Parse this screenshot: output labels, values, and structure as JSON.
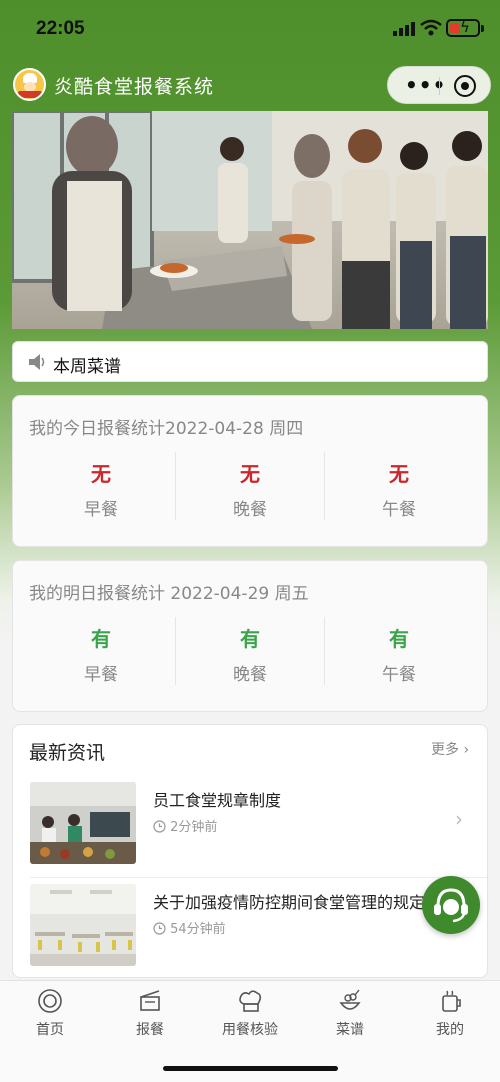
{
  "status_bar": {
    "time": "22:05",
    "icons": [
      "signal-icon",
      "wifi-icon",
      "battery-charging-icon"
    ]
  },
  "header": {
    "title": "炎酷食堂报餐系统",
    "logo": "canteen-logo",
    "menu_icon": "more-dots-icon",
    "close_icon": "target-icon"
  },
  "banner": {
    "description_icon": "canteen-photo"
  },
  "notice": {
    "icon": "speaker-icon",
    "label": "本周菜谱"
  },
  "today_stats": {
    "title": "我的今日报餐统计2022-04-28 周四",
    "items": [
      {
        "value": "无",
        "meal": "早餐"
      },
      {
        "value": "无",
        "meal": "晚餐"
      },
      {
        "value": "无",
        "meal": "午餐"
      }
    ],
    "value_color": "#c8272b"
  },
  "tomorrow_stats": {
    "title": "我的明日报餐统计 2022-04-29 周五",
    "items": [
      {
        "value": "有",
        "meal": "早餐"
      },
      {
        "value": "有",
        "meal": "晚餐"
      },
      {
        "value": "有",
        "meal": "午餐"
      }
    ],
    "value_color": "#39a44a"
  },
  "news": {
    "heading": "最新资讯",
    "more": "更多",
    "items": [
      {
        "title": "员工食堂规章制度",
        "time": "2分钟前"
      },
      {
        "title": "关于加强疫情防控期间食堂管理的规定",
        "time": "54分钟前"
      }
    ]
  },
  "fab": {
    "icon": "customer-service-icon"
  },
  "tabbar": {
    "items": [
      {
        "label": "首页",
        "icon": "home-icon"
      },
      {
        "label": "报餐",
        "icon": "order-meal-icon"
      },
      {
        "label": "用餐核验",
        "icon": "chef-hat-icon"
      },
      {
        "label": "菜谱",
        "icon": "menu-dish-icon"
      },
      {
        "label": "我的",
        "icon": "profile-icon"
      }
    ]
  },
  "colors": {
    "brand_green": "#4e8f2c",
    "accent_red": "#c8272b",
    "accent_green": "#39a44a"
  }
}
